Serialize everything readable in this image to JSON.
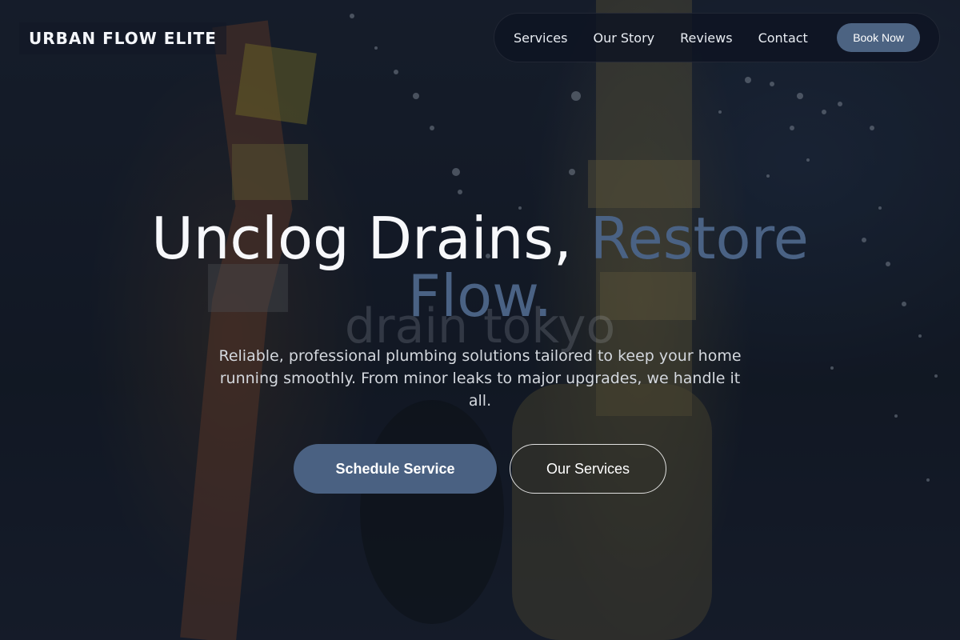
{
  "brand": {
    "name": "URBAN FLOW ELITE"
  },
  "nav": {
    "items": [
      "Services",
      "Our Story",
      "Reviews",
      "Contact"
    ],
    "book_label": "Book Now"
  },
  "hero": {
    "headline_main": "Unclog Drains, ",
    "headline_accent": "Restore Flow.",
    "ghost_text": "drain tokyo",
    "subtitle": "Reliable, professional plumbing solutions tailored to keep your home running smoothly. From minor leaks to major upgrades, we handle it all.",
    "primary_cta": "Schedule Service",
    "secondary_cta": "Our Services"
  },
  "colors": {
    "accent": "#4a6182",
    "background": "#151b27",
    "nav_bg": "#0e1422"
  }
}
